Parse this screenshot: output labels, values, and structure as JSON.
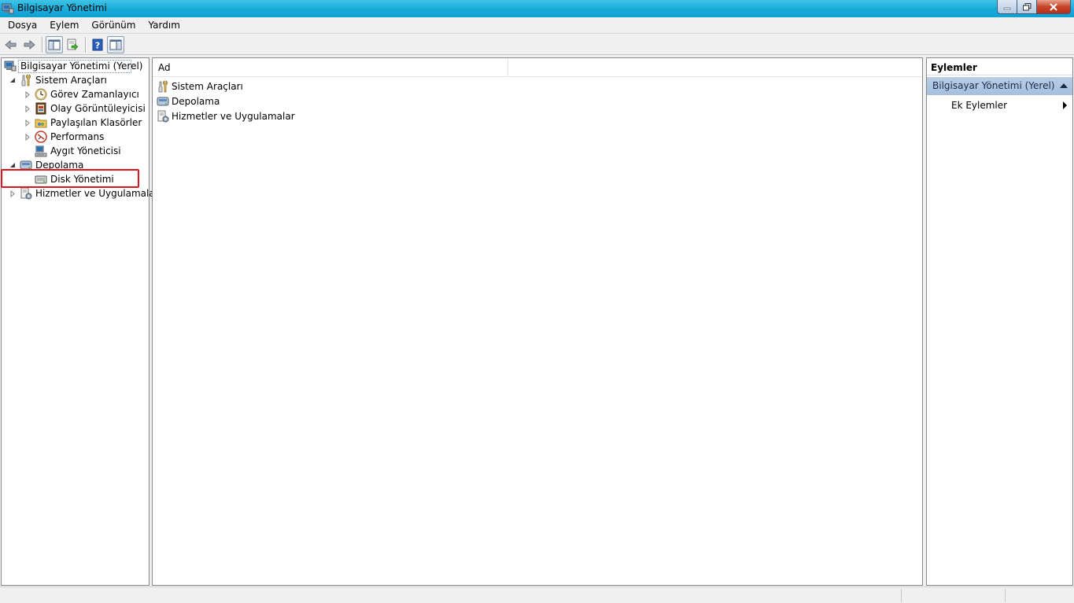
{
  "window": {
    "title": "Bilgisayar Yönetimi"
  },
  "menu": [
    "Dosya",
    "Eylem",
    "Görünüm",
    "Yardım"
  ],
  "toolbar": [
    "back-icon",
    "forward-icon",
    "show-hide-tree-icon",
    "export-list-icon",
    "help-icon",
    "show-hide-action-pane-icon"
  ],
  "tree": {
    "root": "Bilgisayar Yönetimi (Yerel)",
    "items": [
      {
        "label": "Sistem Araçları",
        "icon": "tools-icon",
        "state": "expanded"
      },
      {
        "label": "Görev Zamanlayıcı",
        "icon": "clock-icon",
        "state": "collapsed"
      },
      {
        "label": "Olay Görüntüleyicisi",
        "icon": "event-viewer-icon",
        "state": "collapsed"
      },
      {
        "label": "Paylaşılan Klasörler",
        "icon": "shared-folder-icon",
        "state": "collapsed"
      },
      {
        "label": "Performans",
        "icon": "performance-icon",
        "state": "collapsed"
      },
      {
        "label": "Aygıt Yöneticisi",
        "icon": "device-manager-icon",
        "state": "leaf"
      },
      {
        "label": "Depolama",
        "icon": "storage-icon",
        "state": "expanded"
      },
      {
        "label": "Disk Yönetimi",
        "icon": "disk-icon",
        "state": "leaf"
      },
      {
        "label": "Hizmetler ve Uygulamalar",
        "icon": "services-icon",
        "state": "collapsed"
      }
    ],
    "highlight_color": "#e0141e"
  },
  "list": {
    "column_header": "Ad",
    "items": [
      "Sistem Araçları",
      "Depolama",
      "Hizmetler ve Uygulamalar"
    ]
  },
  "actions": {
    "header": "Eylemler",
    "section": "Bilgisayar Yönetimi (Yerel)",
    "item": "Ek Eylemler"
  },
  "colors": {
    "titlebar": "#1aaddb",
    "section": "#b9cde5"
  }
}
